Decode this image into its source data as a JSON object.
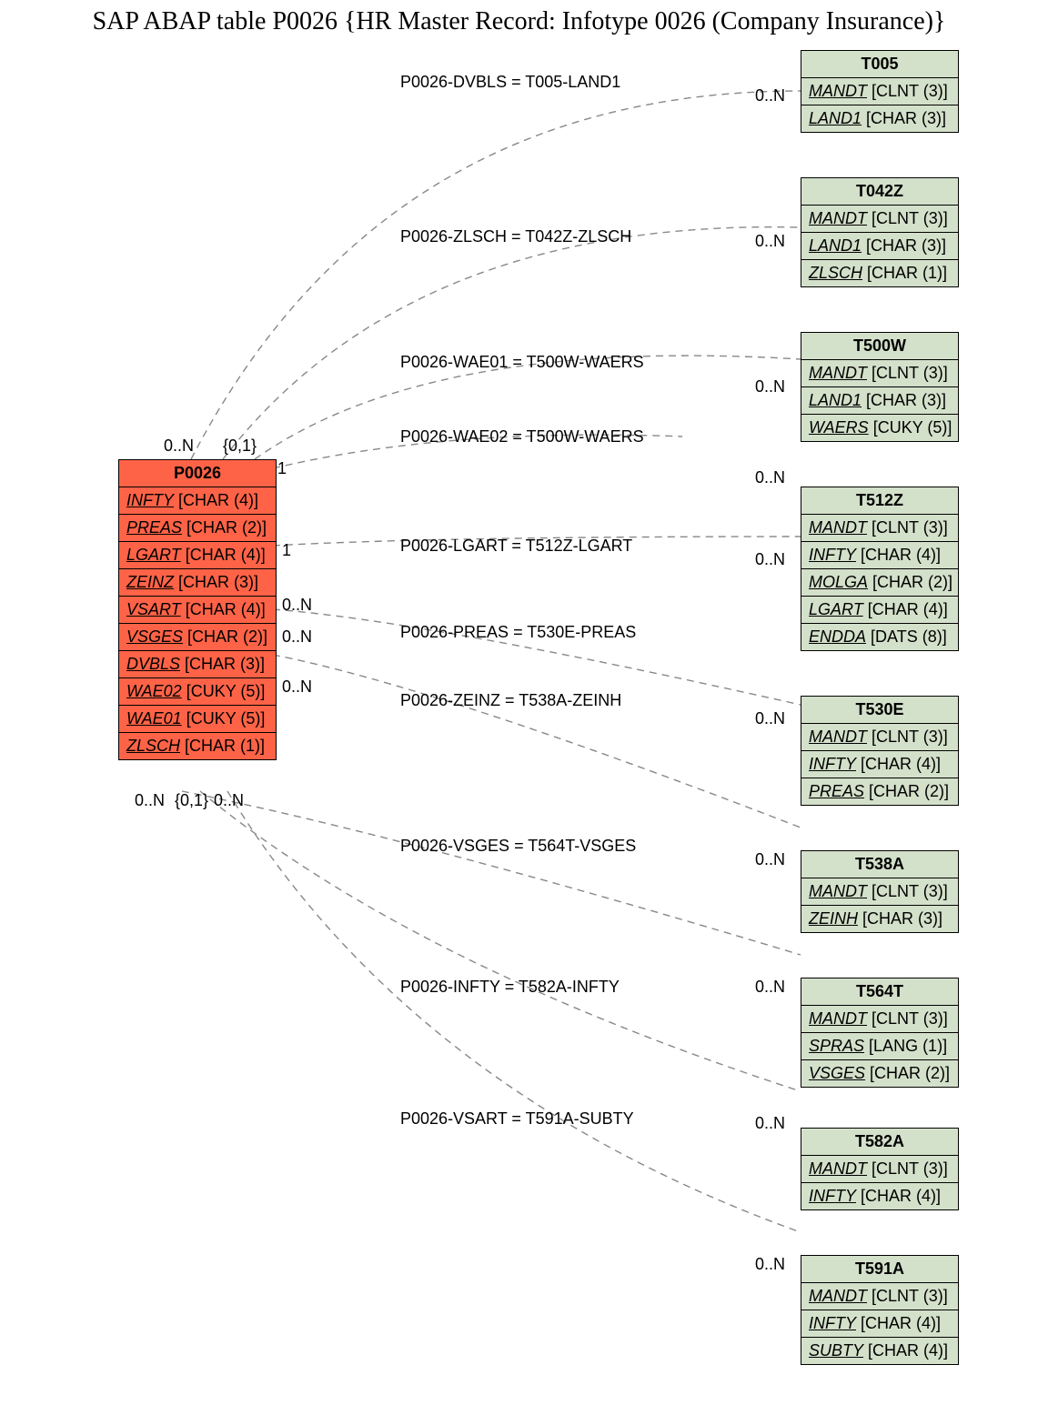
{
  "title": "SAP ABAP table P0026 {HR Master Record: Infotype 0026 (Company Insurance)}",
  "main_entity": {
    "name": "P0026",
    "fields": [
      {
        "name": "INFTY",
        "type": "[CHAR (4)]"
      },
      {
        "name": "PREAS",
        "type": "[CHAR (2)]"
      },
      {
        "name": "LGART",
        "type": "[CHAR (4)]"
      },
      {
        "name": "ZEINZ",
        "type": "[CHAR (3)]"
      },
      {
        "name": "VSART",
        "type": "[CHAR (4)]"
      },
      {
        "name": "VSGES",
        "type": "[CHAR (2)]"
      },
      {
        "name": "DVBLS",
        "type": "[CHAR (3)]"
      },
      {
        "name": "WAE02",
        "type": "[CUKY (5)]"
      },
      {
        "name": "WAE01",
        "type": "[CUKY (5)]"
      },
      {
        "name": "ZLSCH",
        "type": "[CHAR (1)]"
      }
    ]
  },
  "targets": [
    {
      "name": "T005",
      "fields": [
        {
          "name": "MANDT",
          "type": "[CLNT (3)]"
        },
        {
          "name": "LAND1",
          "type": "[CHAR (3)]"
        }
      ]
    },
    {
      "name": "T042Z",
      "fields": [
        {
          "name": "MANDT",
          "type": "[CLNT (3)]"
        },
        {
          "name": "LAND1",
          "type": "[CHAR (3)]"
        },
        {
          "name": "ZLSCH",
          "type": "[CHAR (1)]"
        }
      ]
    },
    {
      "name": "T500W",
      "fields": [
        {
          "name": "MANDT",
          "type": "[CLNT (3)]"
        },
        {
          "name": "LAND1",
          "type": "[CHAR (3)]"
        },
        {
          "name": "WAERS",
          "type": "[CUKY (5)]"
        }
      ]
    },
    {
      "name": "T512Z",
      "fields": [
        {
          "name": "MANDT",
          "type": "[CLNT (3)]"
        },
        {
          "name": "INFTY",
          "type": "[CHAR (4)]"
        },
        {
          "name": "MOLGA",
          "type": "[CHAR (2)]"
        },
        {
          "name": "LGART",
          "type": "[CHAR (4)]"
        },
        {
          "name": "ENDDA",
          "type": "[DATS (8)]"
        }
      ]
    },
    {
      "name": "T530E",
      "fields": [
        {
          "name": "MANDT",
          "type": "[CLNT (3)]"
        },
        {
          "name": "INFTY",
          "type": "[CHAR (4)]"
        },
        {
          "name": "PREAS",
          "type": "[CHAR (2)]"
        }
      ]
    },
    {
      "name": "T538A",
      "fields": [
        {
          "name": "MANDT",
          "type": "[CLNT (3)]"
        },
        {
          "name": "ZEINH",
          "type": "[CHAR (3)]"
        }
      ]
    },
    {
      "name": "T564T",
      "fields": [
        {
          "name": "MANDT",
          "type": "[CLNT (3)]"
        },
        {
          "name": "SPRAS",
          "type": "[LANG (1)]"
        },
        {
          "name": "VSGES",
          "type": "[CHAR (2)]"
        }
      ]
    },
    {
      "name": "T582A",
      "fields": [
        {
          "name": "MANDT",
          "type": "[CLNT (3)]"
        },
        {
          "name": "INFTY",
          "type": "[CHAR (4)]"
        }
      ]
    },
    {
      "name": "T591A",
      "fields": [
        {
          "name": "MANDT",
          "type": "[CLNT (3)]"
        },
        {
          "name": "INFTY",
          "type": "[CHAR (4)]"
        },
        {
          "name": "SUBTY",
          "type": "[CHAR (4)]"
        }
      ]
    }
  ],
  "relations": [
    {
      "label": "P0026-DVBLS = T005-LAND1"
    },
    {
      "label": "P0026-ZLSCH = T042Z-ZLSCH"
    },
    {
      "label": "P0026-WAE01 = T500W-WAERS"
    },
    {
      "label": "P0026-WAE02 = T500W-WAERS"
    },
    {
      "label": "P0026-LGART = T512Z-LGART"
    },
    {
      "label": "P0026-PREAS = T530E-PREAS"
    },
    {
      "label": "P0026-ZEINZ = T538A-ZEINH"
    },
    {
      "label": "P0026-VSGES = T564T-VSGES"
    },
    {
      "label": "P0026-INFTY = T582A-INFTY"
    },
    {
      "label": "P0026-VSART = T591A-SUBTY"
    }
  ],
  "card_left": [
    {
      "text": "0..N"
    },
    {
      "text": "{0,1}"
    },
    {
      "text": "1"
    },
    {
      "text": "1"
    },
    {
      "text": "0..N"
    },
    {
      "text": "0..N"
    },
    {
      "text": "0..N"
    },
    {
      "text": "0..N"
    },
    {
      "text": "{0,1}"
    },
    {
      "text": "0..N"
    }
  ],
  "card_right": [
    {
      "text": "0..N"
    },
    {
      "text": "0..N"
    },
    {
      "text": "0..N"
    },
    {
      "text": "0..N"
    },
    {
      "text": "0..N"
    },
    {
      "text": "0..N"
    },
    {
      "text": "0..N"
    },
    {
      "text": "0..N"
    },
    {
      "text": "0..N"
    },
    {
      "text": "0..N"
    }
  ]
}
